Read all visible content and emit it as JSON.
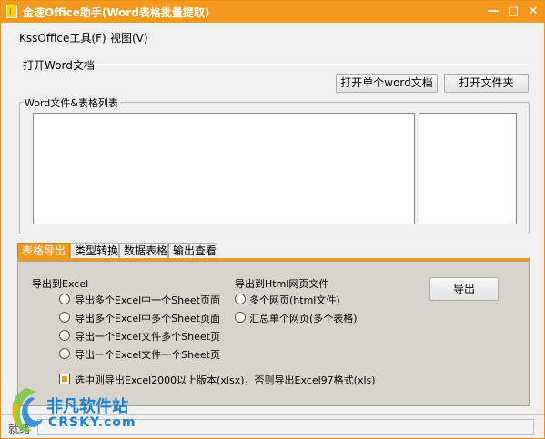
{
  "window": {
    "title": "金速Office助手(Word表格批量提取)",
    "minimize_glyph": "—",
    "maximize_glyph": "□",
    "close_glyph": "✕"
  },
  "menu": {
    "items": [
      {
        "label": "KssOffice工具(F)"
      },
      {
        "label": "视图(V)"
      }
    ]
  },
  "open_section": {
    "label": "打开Word文档",
    "open_single_button": "打开单个word文档",
    "open_folder_button": "打开文件夹"
  },
  "list_section": {
    "label": "Word文件&表格列表"
  },
  "tabs": [
    {
      "label": "表格导出",
      "active": true
    },
    {
      "label": "类型转换",
      "active": false
    },
    {
      "label": "数据表格",
      "active": false
    },
    {
      "label": "输出查看",
      "active": false
    }
  ],
  "export_panel": {
    "excel_heading": "导出到Excel",
    "excel_options": [
      "导出多个Excel中一个Sheet页面",
      "导出多个Excel中多个Sheet页面",
      "导出一个Excel文件多个Sheet页",
      "导出一个Excel文件一个Sheet页"
    ],
    "html_heading": "导出到Html网页文件",
    "html_options": [
      "多个网页(html文件)",
      "汇总单个网页(多个表格)"
    ],
    "export_button": "导出",
    "version_checkbox_label": "选中则导出Excel2000以上版本(xlsx)，否则导出Excel97格式(xls)",
    "version_checkbox_checked": true
  },
  "status": {
    "text": "就绪"
  },
  "watermark": {
    "text": "非凡软件站",
    "sub": "CRSKY.com"
  },
  "colors": {
    "accent": "#f39a1e",
    "panel_bg": "#d8d4cc",
    "watermark": "#1c83d4"
  }
}
